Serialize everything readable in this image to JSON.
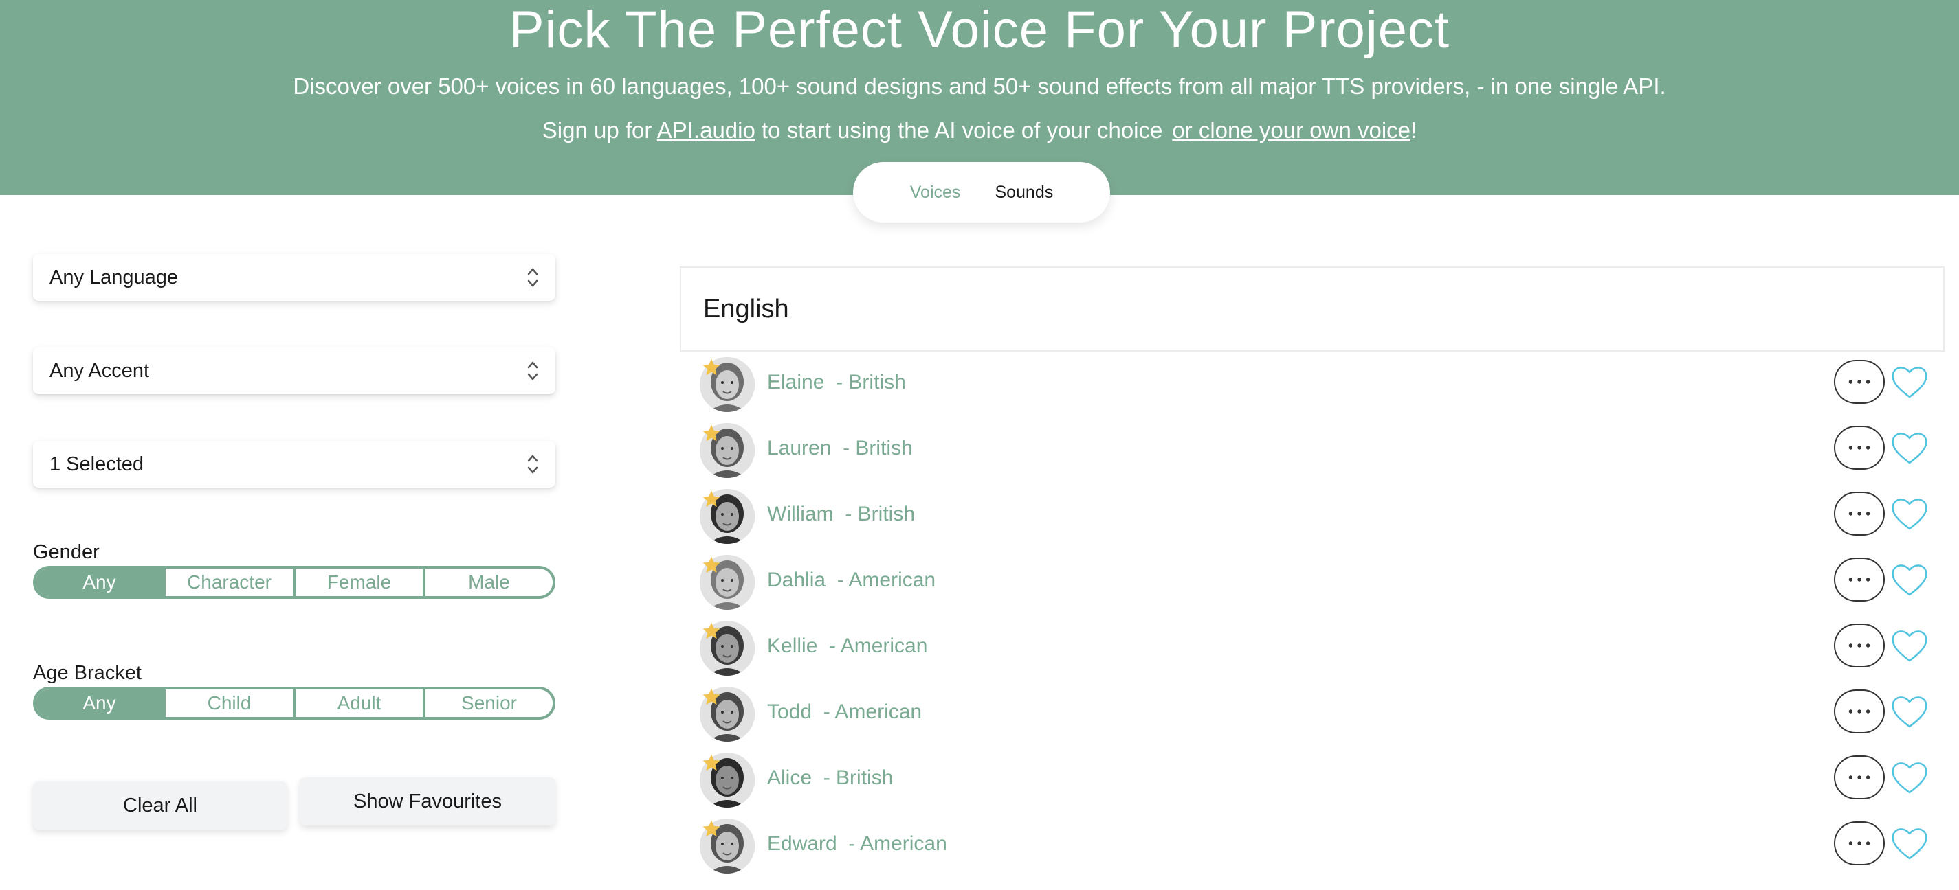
{
  "header": {
    "title": "Pick The Perfect Voice For Your Project",
    "subtitle": "Discover over 500+ voices in 60 languages, 100+ sound designs and 50+ sound effects from all major TTS providers, - in one single API.",
    "signup_prefix": "Sign up for ",
    "signup_link": "API.audio",
    "signup_middle": " to start using the AI voice of your choice",
    "clone_link": "or clone your own voice",
    "clone_suffix": "!"
  },
  "tabs": {
    "voices": "Voices",
    "sounds": "Sounds",
    "active": "Voices"
  },
  "filters": {
    "language": "Any Language",
    "accent": "Any Accent",
    "selected": "1 Selected",
    "gender": {
      "label": "Gender",
      "options": [
        "Any",
        "Character",
        "Female",
        "Male"
      ],
      "active": "Any"
    },
    "age": {
      "label": "Age Bracket",
      "options": [
        "Any",
        "Child",
        "Adult",
        "Senior"
      ],
      "active": "Any"
    },
    "clear_all": "Clear All",
    "show_favourites": "Show Favourites"
  },
  "voice_list": {
    "language_heading": "English",
    "more_icon": "ellipsis-icon",
    "favourite_icon": "heart-outline-icon",
    "voices": [
      {
        "name": "Elaine",
        "accent": "British"
      },
      {
        "name": "Lauren",
        "accent": "British"
      },
      {
        "name": "William",
        "accent": "British"
      },
      {
        "name": "Dahlia",
        "accent": "American"
      },
      {
        "name": "Kellie",
        "accent": "American"
      },
      {
        "name": "Todd",
        "accent": "American"
      },
      {
        "name": "Alice",
        "accent": "British"
      },
      {
        "name": "Edward",
        "accent": "American"
      }
    ]
  },
  "colors": {
    "brand_green": "#7baa93",
    "heart_cyan": "#4fc3e0",
    "star_gold": "#f2c14e"
  }
}
